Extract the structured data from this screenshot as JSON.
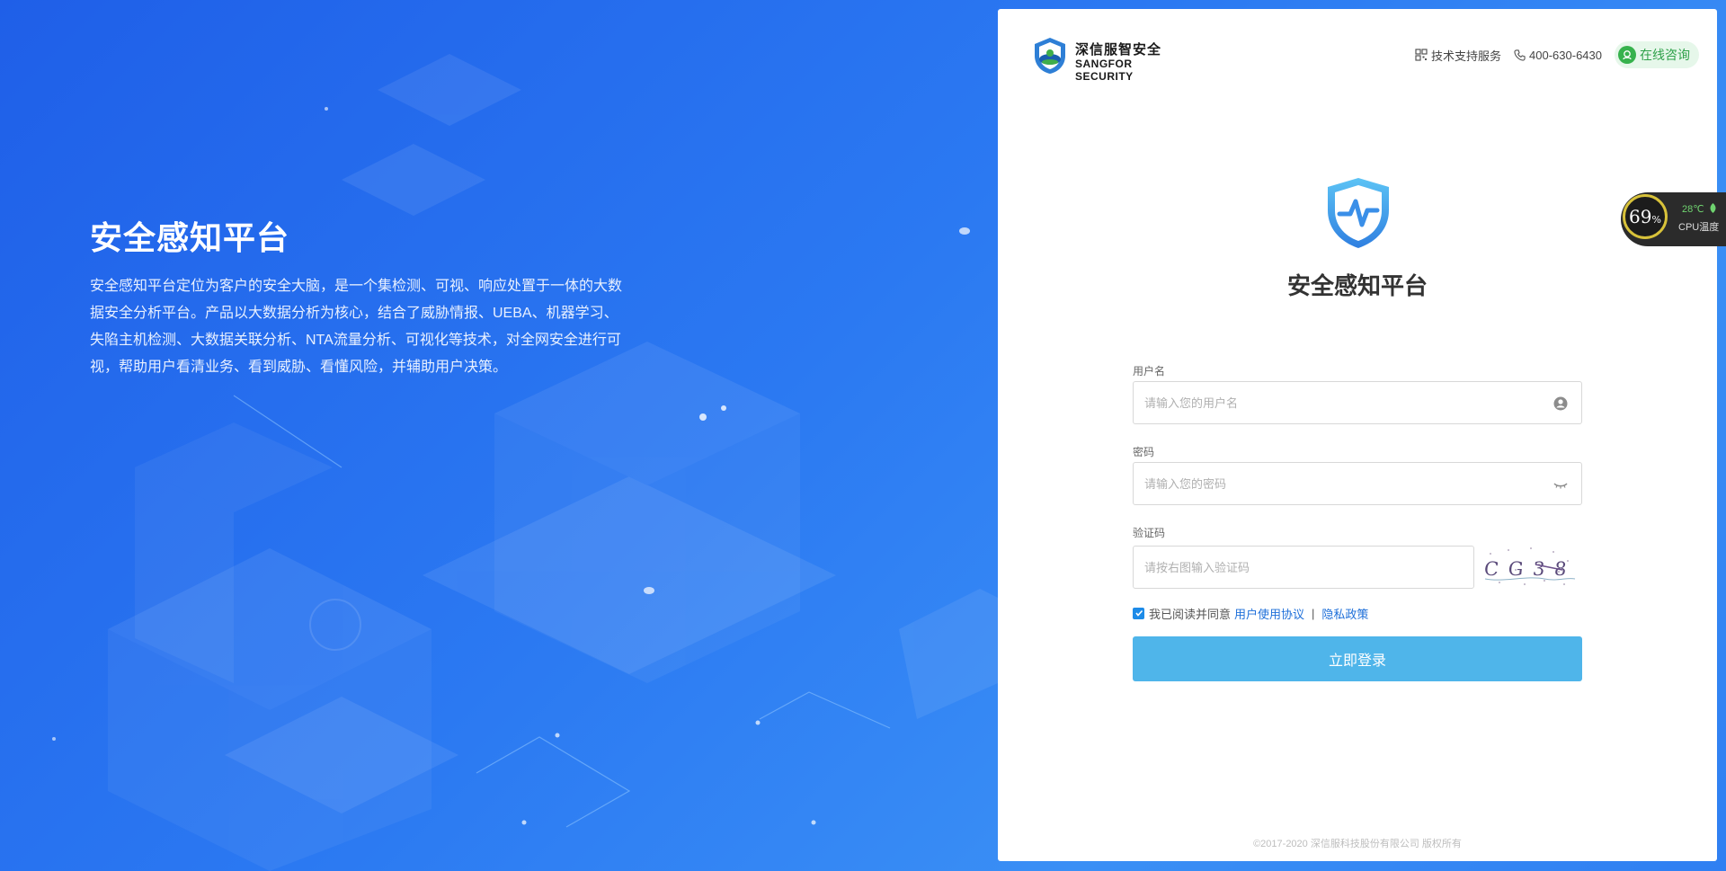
{
  "hero": {
    "title": "安全感知平台",
    "description": "安全感知平台定位为客户的安全大脑，是一个集检测、可视、响应处置于一体的大数据安全分析平台。产品以大数据分析为核心，结合了威胁情报、UEBA、机器学习、失陷主机检测、大数据关联分析、NTA流量分析、可视化等技术，对全网安全进行可视，帮助用户看清业务、看到威胁、看懂风险，并辅助用户决策。"
  },
  "brand": {
    "name_cn": "深信服智安全",
    "name_en": "SANGFOR  SECURITY"
  },
  "topbar": {
    "support_label": "技术支持服务",
    "phone": "400-630-6430",
    "consult_label": "在线咨询"
  },
  "login": {
    "title": "安全感知平台",
    "username_label": "用户名",
    "username_placeholder": "请输入您的用户名",
    "password_label": "密码",
    "password_placeholder": "请输入您的密码",
    "captcha_label": "验证码",
    "captcha_placeholder": "请按右图输入验证码",
    "captcha_text": "C G 3 8",
    "agree_checked": true,
    "agree_text": "我已阅读并同意",
    "user_agreement_link": "用户使用协议",
    "separator": "|",
    "privacy_link": "隐私政策",
    "submit_label": "立即登录"
  },
  "copyright": "©2017-2020 深信服科技股份有限公司 版权所有",
  "cpu_widget": {
    "usage": "69",
    "usage_unit": "%",
    "temperature": "28℃",
    "label": "CPU温度"
  },
  "colors": {
    "accent": "#4fb5ea",
    "link": "#1e6fd9",
    "consult_green": "#37b24d"
  }
}
